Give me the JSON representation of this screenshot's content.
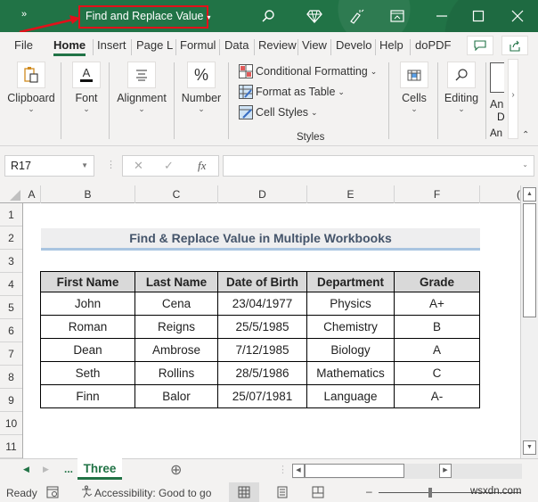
{
  "window": {
    "title": "Find and Replace Value",
    "more_glyph": "»",
    "title_caret": "▾",
    "highlight_color": "#e3101a",
    "accent_color": "#217346"
  },
  "ribbon_tabs": [
    {
      "label": "File",
      "active": false
    },
    {
      "label": "Home",
      "active": true
    },
    {
      "label": "Insert",
      "active": false
    },
    {
      "label": "Page L",
      "active": false
    },
    {
      "label": "Formul",
      "active": false
    },
    {
      "label": "Data",
      "active": false
    },
    {
      "label": "Review",
      "active": false
    },
    {
      "label": "View",
      "active": false
    },
    {
      "label": "Develo",
      "active": false
    },
    {
      "label": "Help",
      "active": false
    },
    {
      "label": "doPDF",
      "active": false
    }
  ],
  "ribbon": {
    "groups": [
      {
        "label": "Clipboard",
        "icon": "clipboard-icon"
      },
      {
        "label": "Font",
        "icon": "font-color-icon"
      },
      {
        "label": "Alignment",
        "icon": "align-icon"
      },
      {
        "label": "Number",
        "icon": "percent-icon"
      },
      {
        "label": "Cells",
        "icon": "cells-icon"
      },
      {
        "label": "Editing",
        "icon": "search-icon"
      },
      {
        "label": "An",
        "sub": "D",
        "icon": "analyze-icon"
      }
    ],
    "styles": {
      "conditional_formatting": "Conditional Formatting",
      "format_as_table": "Format as Table",
      "cell_styles": "Cell Styles",
      "group_label": "Styles",
      "dropdown_glyph": "⌄"
    },
    "chevron_glyph": "⌄",
    "collapse_glyph": "⌃",
    "more_glyph": "›",
    "group_label_analyze": "An"
  },
  "formula_bar": {
    "name_box": "R17",
    "cancel_glyph": "✕",
    "enter_glyph": "✓",
    "fx_label": "fx",
    "formula_value": ""
  },
  "columns": [
    "A",
    "B",
    "C",
    "D",
    "E",
    "F",
    "("
  ],
  "rows": [
    "1",
    "2",
    "3",
    "4",
    "5",
    "6",
    "7",
    "8",
    "9",
    "10",
    "11"
  ],
  "sheet": {
    "title": "Find & Replace Value in Multiple Workbooks",
    "headers": [
      "First Name",
      "Last Name",
      "Date of Birth",
      "Department",
      "Grade"
    ],
    "records": [
      [
        "John",
        "Cena",
        "23/04/1977",
        "Physics",
        "A+"
      ],
      [
        "Roman",
        "Reigns",
        "25/5/1985",
        "Chemistry",
        "B"
      ],
      [
        "Dean",
        "Ambrose",
        "7/12/1985",
        "Biology",
        "A"
      ],
      [
        "Seth",
        "Rollins",
        "28/5/1986",
        "Mathematics",
        "C"
      ],
      [
        "Finn",
        "Balor",
        "25/07/1981",
        "Language",
        "A-"
      ]
    ]
  },
  "sheet_tabs": {
    "prev_glyph": "◀",
    "next_glyph": "▶",
    "ellipsis": "...",
    "active_tab": "Three",
    "add_glyph": "⊕"
  },
  "status_bar": {
    "ready": "Ready",
    "accessibility": "Accessibility: Good to go",
    "zoom_minus": "–",
    "watermark": "wsxdn.com"
  }
}
